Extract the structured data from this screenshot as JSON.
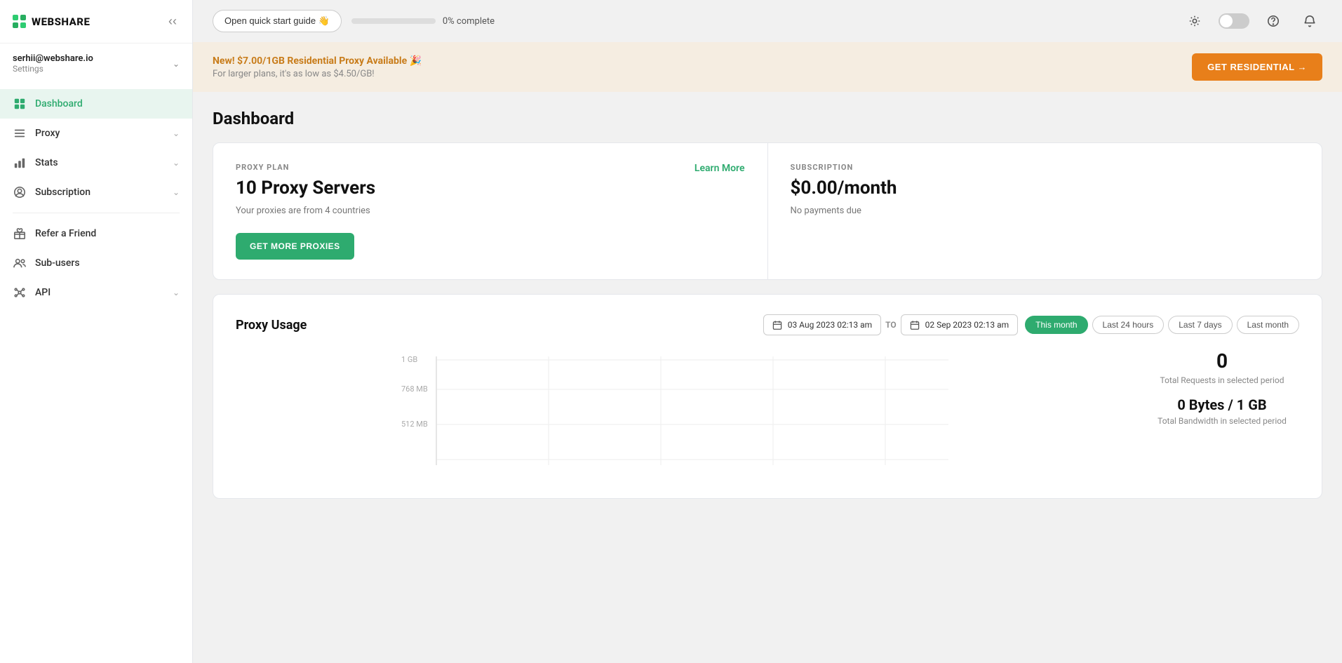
{
  "app": {
    "name": "WEBSHARE"
  },
  "user": {
    "email": "serhii@webshare.io",
    "settings_label": "Settings"
  },
  "topbar": {
    "quick_start_label": "Open quick start guide 👋",
    "progress_percent": "0% complete",
    "progress_value": 0,
    "toggle_aria": "Dark mode toggle"
  },
  "sidebar": {
    "items": [
      {
        "id": "dashboard",
        "label": "Dashboard",
        "icon": "grid-icon",
        "active": true,
        "has_chevron": false
      },
      {
        "id": "proxy",
        "label": "Proxy",
        "icon": "list-icon",
        "active": false,
        "has_chevron": true
      },
      {
        "id": "stats",
        "label": "Stats",
        "icon": "bar-chart-icon",
        "active": false,
        "has_chevron": true
      },
      {
        "id": "subscription",
        "label": "Subscription",
        "icon": "user-circle-icon",
        "active": false,
        "has_chevron": true
      },
      {
        "id": "refer",
        "label": "Refer a Friend",
        "icon": "gift-icon",
        "active": false,
        "has_chevron": false
      },
      {
        "id": "subusers",
        "label": "Sub-users",
        "icon": "users-icon",
        "active": false,
        "has_chevron": false
      },
      {
        "id": "api",
        "label": "API",
        "icon": "api-icon",
        "active": false,
        "has_chevron": true
      }
    ]
  },
  "banner": {
    "primary_text": "New! $7.00/1GB Residential Proxy Available 🎉",
    "secondary_text": "For larger plans, it's as low as $4.50/GB!",
    "cta_label": "GET RESIDENTIAL →"
  },
  "dashboard": {
    "title": "Dashboard",
    "proxy_plan": {
      "label": "PROXY PLAN",
      "value": "10 Proxy Servers",
      "subtitle": "Your proxies are from 4 countries",
      "learn_more": "Learn More",
      "cta": "GET MORE PROXIES"
    },
    "subscription": {
      "label": "SUBSCRIPTION",
      "value": "$0.00/month",
      "subtitle": "No payments due"
    },
    "proxy_usage": {
      "title": "Proxy Usage",
      "date_from": "03 Aug 2023 02:13 am",
      "date_to": "02 Sep 2023 02:13 am",
      "date_sep": "TO",
      "filters": [
        "This month",
        "Last 24 hours",
        "Last 7 days",
        "Last month"
      ],
      "active_filter": "This month",
      "total_requests_label": "Total Requests in selected period",
      "total_requests_value": "0",
      "bandwidth_label": "Total Bandwidth in selected period",
      "bandwidth_value": "0 Bytes / 1 GB",
      "chart_labels": [
        "1 GB",
        "768 MB",
        "512 MB"
      ]
    }
  }
}
